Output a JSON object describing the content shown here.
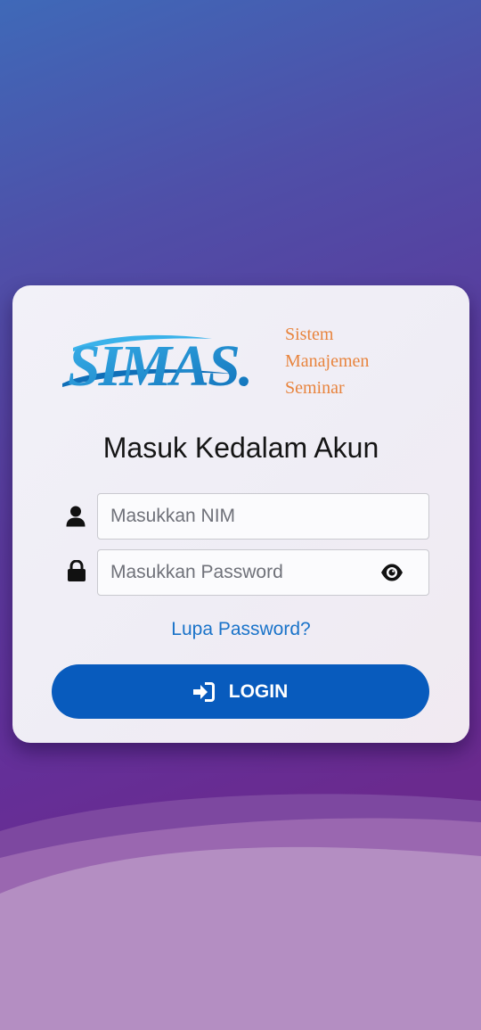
{
  "app": {
    "logo_text": "SIMAS.",
    "tagline": [
      "Sistem",
      "Manajemen",
      "Seminar"
    ]
  },
  "login": {
    "heading": "Masuk Kedalam Akun",
    "nim_field": {
      "value": "",
      "placeholder": "Masukkan NIM",
      "icon": "user-icon"
    },
    "password_field": {
      "value": "",
      "placeholder": "Masukkan Password",
      "icon": "lock-icon",
      "toggle_icon": "eye-icon"
    },
    "forgot_link": "Lupa Password?",
    "submit_button": {
      "label": "LOGIN",
      "icon": "sign-in-icon"
    }
  },
  "colors": {
    "primary_button": "#085bbd",
    "link": "#1a73c9",
    "logo_blue": "#1f9ad8",
    "tagline_orange": "#e8843e"
  }
}
